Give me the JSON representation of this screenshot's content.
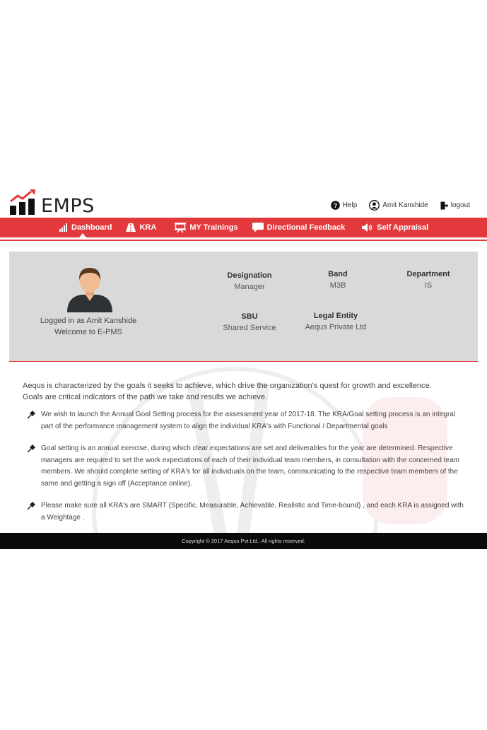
{
  "app": {
    "title": "EMPS"
  },
  "top_links": [
    {
      "label": "Help",
      "icon": "help-icon"
    },
    {
      "label": "Amit Kanshide",
      "icon": "user-icon"
    },
    {
      "label": "logout",
      "icon": "logout-icon"
    }
  ],
  "nav": {
    "items": [
      {
        "label": "Dashboard",
        "icon": "bar-chart-icon",
        "active": true
      },
      {
        "label": "KRA",
        "icon": "road-icon"
      },
      {
        "label": "MY Trainings",
        "icon": "presentation-icon"
      },
      {
        "label": "Directional Feedback",
        "icon": "chat-icon"
      },
      {
        "label": "Self Appraisal",
        "icon": "megaphone-icon"
      }
    ]
  },
  "profile": {
    "logged_in_text": "Logged in as Amit Kanshide",
    "welcome_text": "Welcome to E-PMS",
    "designation": {
      "label": "Designation",
      "value": "Manager"
    },
    "band": {
      "label": "Band",
      "value": "M3B"
    },
    "department": {
      "label": "Department",
      "value": "IS"
    },
    "sbu": {
      "label": "SBU",
      "value": "Shared Service"
    },
    "legal_entity": {
      "label": "Legal Entity",
      "value": "Aequs Private Ltd"
    }
  },
  "content": {
    "intro_1": "Aequs is characterized by the goals it seeks to achieve, which drive the organization's quest for growth and excellence.",
    "intro_2": "Goals are critical indicators of the path we take and results we achieve.",
    "bullets": [
      "We wish to launch the Annual Goal Setting process for the assessment year of 2017-18. The KRA/Goal setting process is an integral part of the performance management system to align the individual KRA's with Functional / Departmental goals",
      "Goal setting is an annual exercise, during which clear expectations are set and deliverables for the year are determined. Respective managers are required to set the work expectations of each of their individual team members, in consultation with the concerned team members. We should complete setting of KRA's for all individuals on the team, communicating to the respective team members of the same and getting a sign off (Acceptance online).",
      "Please make sure all KRA's are SMART (Specific, Measurable, Achievable, Realistic and Time-bound) , and each KRA is assigned with a Weightage ."
    ]
  },
  "footer": {
    "text": "Copyright © 2017 Aequs Pvt Ltd.. All rights reserved."
  },
  "colors": {
    "accent": "#e4393c",
    "panel": "#d9d9d9",
    "footer": "#0a0a0a"
  }
}
